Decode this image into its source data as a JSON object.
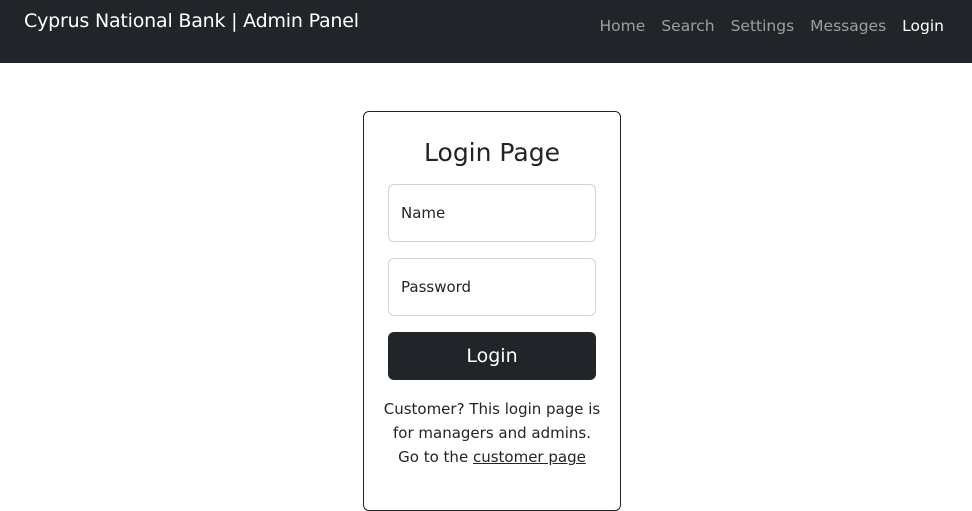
{
  "navbar": {
    "brand": "Cyprus National Bank | Admin Panel",
    "links": [
      {
        "label": "Home"
      },
      {
        "label": "Search"
      },
      {
        "label": "Settings"
      },
      {
        "label": "Messages"
      },
      {
        "label": "Login",
        "active": true
      }
    ]
  },
  "login": {
    "title": "Login Page",
    "name_label": "Name",
    "password_label": "Password",
    "submit_label": "Login",
    "note_line1": "Customer? This login page is",
    "note_line2": "for managers and admins.",
    "note_line3_prefix": "Go to the",
    "customer_link": "customer page"
  },
  "colors": {
    "navbar_bg": "#212529",
    "button_bg": "#212529",
    "input_border": "#ced4da"
  }
}
